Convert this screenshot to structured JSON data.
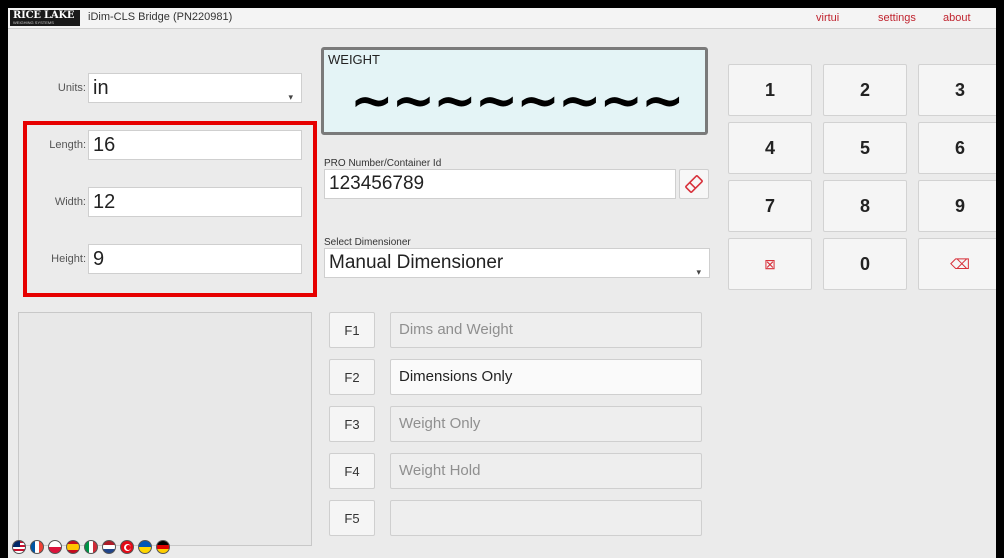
{
  "header": {
    "logo_text": "RICE LAKE",
    "logo_subtext": "WEIGHING SYSTEMS",
    "title": "iDim-CLS Bridge (PN220981)",
    "nav": [
      "virtui",
      "settings",
      "about"
    ]
  },
  "units": {
    "label": "Units:",
    "value": "in"
  },
  "dimensions": [
    {
      "label": "Length:",
      "value": "16"
    },
    {
      "label": "Width:",
      "value": "12"
    },
    {
      "label": "Height:",
      "value": "9"
    }
  ],
  "weight": {
    "label": "WEIGHT",
    "value": "~~~~~~~~"
  },
  "pro": {
    "label": "PRO Number/Container Id",
    "value": "123456789"
  },
  "dimensioner": {
    "label": "Select Dimensioner",
    "value": "Manual Dimensioner"
  },
  "keypad": [
    "1",
    "2",
    "3",
    "4",
    "5",
    "6",
    "7",
    "8",
    "9",
    "⊠",
    "0",
    "⌫"
  ],
  "functions": [
    {
      "key": "F1",
      "label": "Dims and Weight"
    },
    {
      "key": "F2",
      "label": "Dimensions Only"
    },
    {
      "key": "F3",
      "label": "Weight Only"
    },
    {
      "key": "F4",
      "label": "Weight Hold"
    },
    {
      "key": "F5",
      "label": ""
    }
  ],
  "flags": [
    "us-flag",
    "france-flag",
    "poland-flag",
    "spain-flag",
    "italy-flag",
    "netherlands-flag",
    "turkey-flag",
    "ukraine-flag",
    "germany-flag"
  ],
  "colors": {
    "accent": "#c0242f",
    "highlight": "#e60000",
    "weight_bg": "#e4f4f6"
  }
}
